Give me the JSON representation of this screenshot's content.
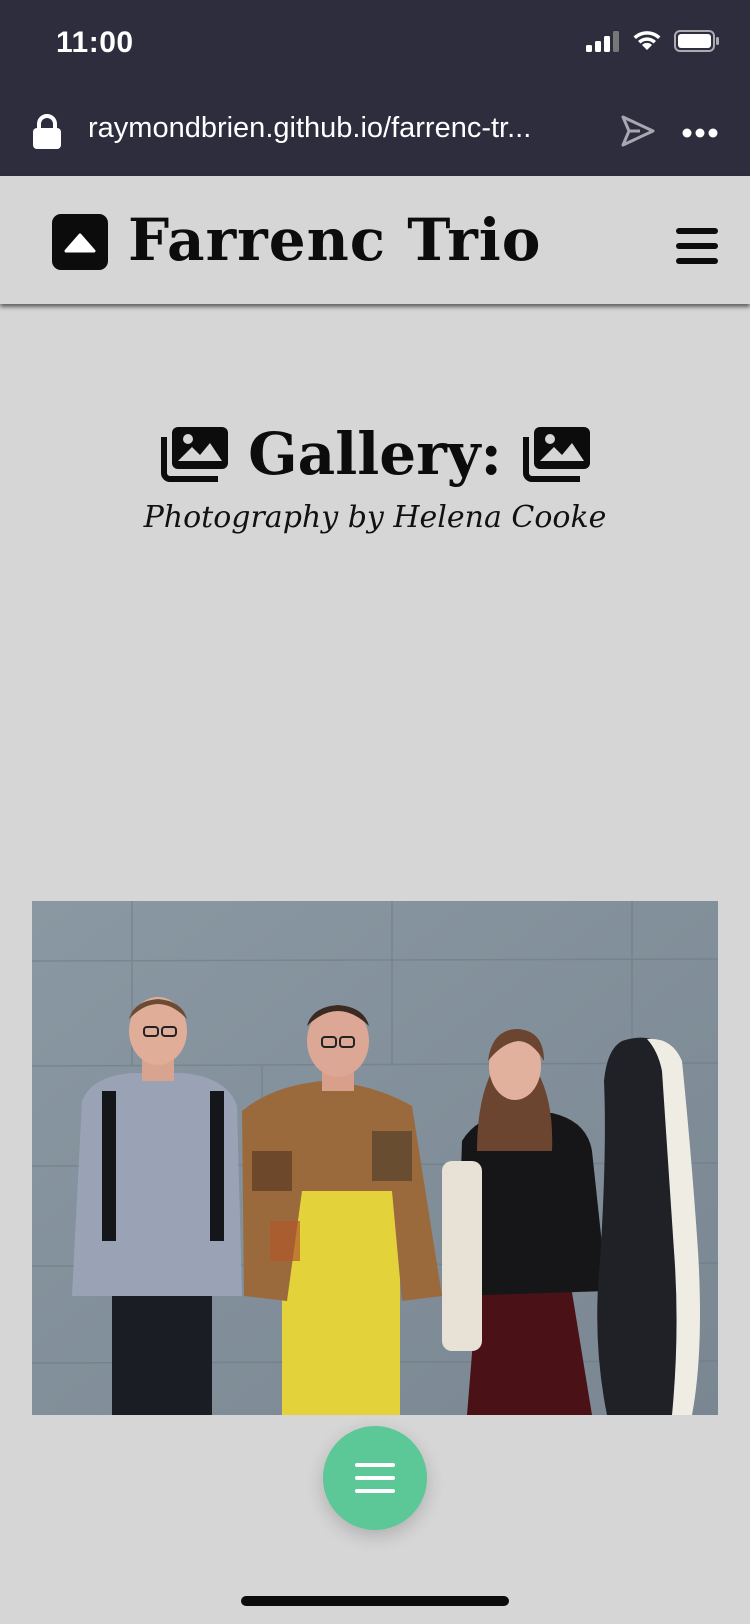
{
  "status_bar": {
    "time": "11:00",
    "battery_level": 0.9
  },
  "browser": {
    "url": "raymondbrien.github.io/farrenc-tr..."
  },
  "header": {
    "title": "Farrenc Trio",
    "logo_icon": "caret-up-square-icon",
    "menu_icon": "hamburger-icon"
  },
  "gallery": {
    "heading": "Gallery:",
    "heading_icon": "images-icon",
    "subheading": "Photography by Helena Cooke"
  },
  "photo": {
    "subject": "three-musicians-photo"
  },
  "fab": {
    "icon": "hamburger-icon",
    "color": "#5cc797"
  },
  "colors": {
    "browser_chrome": "#2d2d3e",
    "page_bg": "#d6d6d6",
    "text": "#0c0c0c"
  }
}
